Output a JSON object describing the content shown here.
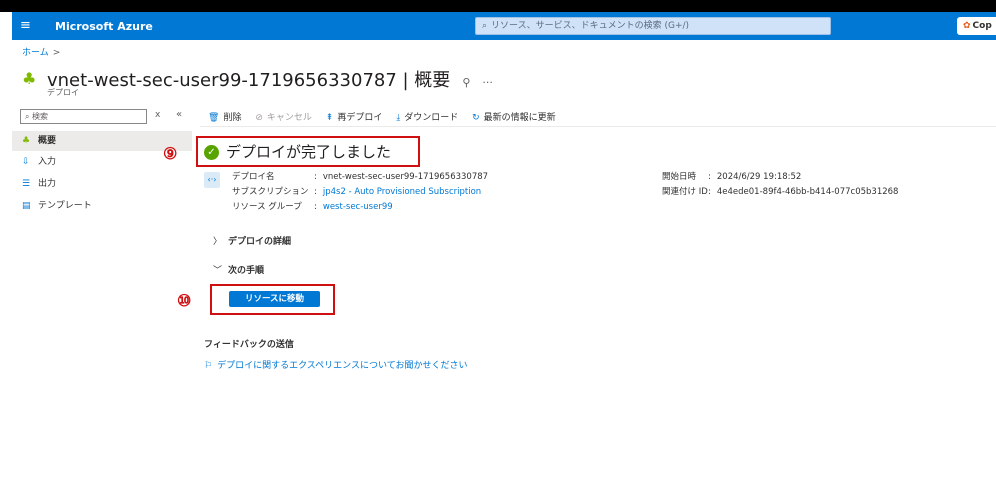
{
  "topbar": {
    "brand": "Microsoft Azure",
    "search_placeholder": "リソース、サービス、ドキュメントの検索 (G+/)",
    "copilot_label": "Cop",
    "menu_icon": "hamburger-icon"
  },
  "breadcrumb": {
    "home": "ホーム",
    "separator": ">"
  },
  "header": {
    "title": "vnet-west-sec-user99-1719656330787 | 概要",
    "subtitle": "デプロイ",
    "pin_glyph": "⚲",
    "more_glyph": "···"
  },
  "sidebar": {
    "search_placeholder": "検索",
    "clear": "x",
    "collapse": "«",
    "items": [
      {
        "label": "概要",
        "icon": "overview-icon",
        "active": true
      },
      {
        "label": "入力",
        "icon": "input-icon",
        "active": false
      },
      {
        "label": "出力",
        "icon": "output-icon",
        "active": false
      },
      {
        "label": "テンプレート",
        "icon": "template-icon",
        "active": false
      }
    ]
  },
  "toolbar": {
    "delete": "削除",
    "cancel": "キャンセル",
    "redeploy": "再デプロイ",
    "download": "ダウンロード",
    "refresh": "最新の情報に更新"
  },
  "annotations": {
    "step9": "⑨",
    "step10": "⑩"
  },
  "status": {
    "message": "デプロイが完了しました",
    "check": "✓"
  },
  "details": {
    "deployment_name_label": "デプロイ名",
    "deployment_name": "vnet-west-sec-user99-1719656330787",
    "subscription_label": "サブスクリプション",
    "subscription": "jp4s2 - Auto Provisioned Subscription",
    "resource_group_label": "リソース グループ",
    "resource_group": "west-sec-user99",
    "start_time_label": "開始日時",
    "start_time": "2024/6/29 19:18:52",
    "correlation_label": "関連付け ID",
    "correlation_id": "4e4ede01-89f4-46bb-b414-077c05b31268",
    "colon": ":"
  },
  "sections": {
    "details_title": "デプロイの詳細",
    "next_steps_title": "次の手順",
    "go_to_resource": "リソースに移動"
  },
  "feedback": {
    "title": "フィードバックの送信",
    "link": "デプロイに関するエクスペリエンスについてお聞かせください"
  }
}
